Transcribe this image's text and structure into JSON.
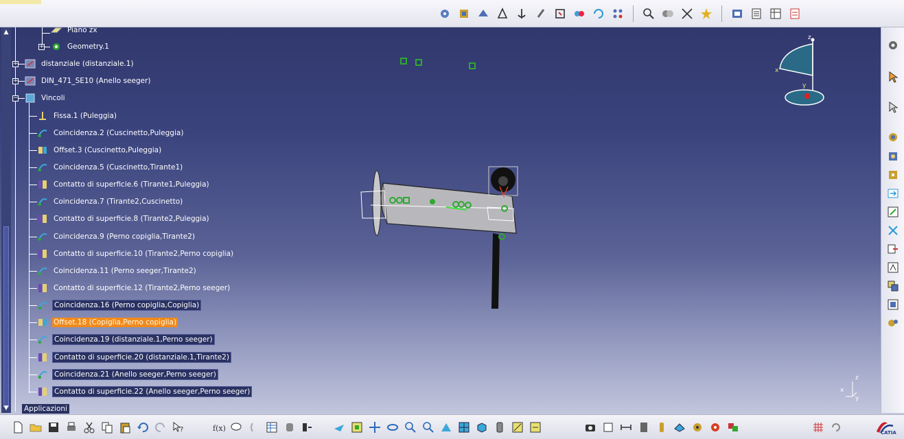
{
  "tree": {
    "items": [
      {
        "label": "Piano zx",
        "style": "normal"
      },
      {
        "label": "Geometry.1",
        "style": "normal"
      },
      {
        "label": "distanziale (distanziale.1)",
        "style": "normal"
      },
      {
        "label": "DIN_471_SE10 (Anello seeger)",
        "style": "normal"
      },
      {
        "label": "Vincoli",
        "style": "normal"
      },
      {
        "label": "Fissa.1 (Puleggia)",
        "style": "normal"
      },
      {
        "label": "Coincidenza.2 (Cuscinetto,Puleggia)",
        "style": "normal"
      },
      {
        "label": "Offset.3 (Cuscinetto,Puleggia)",
        "style": "normal"
      },
      {
        "label": "Coincidenza.5 (Cuscinetto,Tirante1)",
        "style": "normal"
      },
      {
        "label": "Contatto di superficie.6 (Tirante1,Puleggia)",
        "style": "normal"
      },
      {
        "label": "Coincidenza.7 (Tirante2,Cuscinetto)",
        "style": "normal"
      },
      {
        "label": "Contatto di superficie.8 (Tirante2,Puleggia)",
        "style": "normal"
      },
      {
        "label": "Coincidenza.9 (Perno copiglia,Tirante2)",
        "style": "normal"
      },
      {
        "label": "Contatto di superficie.10 (Tirante2,Perno copiglia)",
        "style": "normal"
      },
      {
        "label": "Coincidenza.11 (Perno seeger,Tirante2)",
        "style": "normal"
      },
      {
        "label": "Contatto di superficie.12 (Tirante2,Perno seeger)",
        "style": "normal"
      },
      {
        "label": "Coincidenza.16 (Perno copiglia,Copiglia)",
        "style": "selected"
      },
      {
        "label": "Offset.18 (Copiglia,Perno copiglia)",
        "style": "highlighted"
      },
      {
        "label": "Coincidenza.19 (distanziale.1,Perno seeger)",
        "style": "selected"
      },
      {
        "label": "Contatto di superficie.20 (distanziale.1,Tirante2)",
        "style": "selected"
      },
      {
        "label": "Coincidenza.21 (Anello seeger,Perno seeger)",
        "style": "selected"
      },
      {
        "label": "Contatto di superficie.22 (Anello seeger,Perno seeger)",
        "style": "selected"
      }
    ],
    "applications_label": "Applicazioni"
  },
  "compass": {
    "axis_x": "x",
    "axis_y": "y",
    "axis_z": "z"
  },
  "mini_axis": {
    "axis_x": "x",
    "axis_y": "y",
    "axis_z": "z"
  },
  "brand": {
    "logo_text": "CATIA"
  },
  "colors": {
    "accent_highlight": "#f08a1c",
    "background_top": "#2e3569",
    "background_bottom": "#d2d5e6",
    "constraint_green": "#2fa82f"
  }
}
